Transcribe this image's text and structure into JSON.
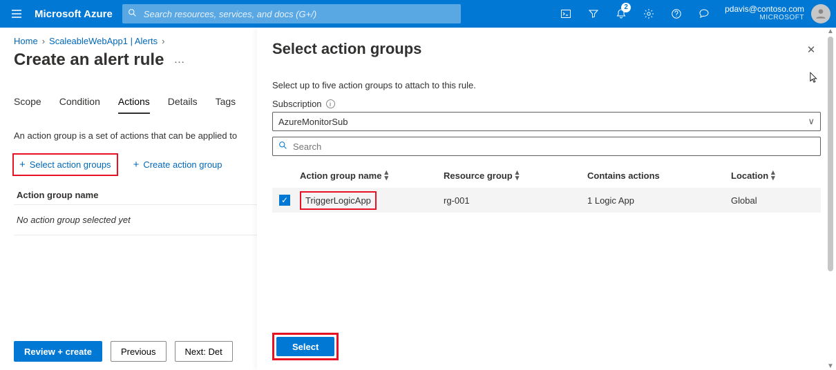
{
  "topbar": {
    "brand": "Microsoft Azure",
    "search_placeholder": "Search resources, services, and docs (G+/)",
    "badge_count": "2",
    "account_email": "pdavis@contoso.com",
    "account_tenant": "MICROSOFT"
  },
  "breadcrumb": {
    "items": [
      "Home",
      "ScaleableWebApp1 | Alerts"
    ]
  },
  "page_title": "Create an alert rule",
  "tabs": {
    "items": [
      "Scope",
      "Condition",
      "Actions",
      "Details",
      "Tags"
    ],
    "active_index": 2
  },
  "help_text": "An action group is a set of actions that can be applied to",
  "ag_buttons": {
    "select": "Select action groups",
    "create": "Create action group"
  },
  "ag_table": {
    "header": "Action group name",
    "empty": "No action group selected yet"
  },
  "footer": {
    "review": "Review + create",
    "previous": "Previous",
    "next": "Next: Det"
  },
  "panel": {
    "title": "Select action groups",
    "subtitle": "Select up to five action groups to attach to this rule.",
    "subscription_label": "Subscription",
    "subscription_value": "AzureMonitorSub",
    "search_placeholder": "Search",
    "columns": {
      "name": "Action group name",
      "rg": "Resource group",
      "contains": "Contains actions",
      "location": "Location"
    },
    "rows": [
      {
        "checked": true,
        "name": "TriggerLogicApp",
        "rg": "rg-001",
        "contains": "1 Logic App",
        "location": "Global"
      }
    ],
    "select_btn": "Select"
  }
}
